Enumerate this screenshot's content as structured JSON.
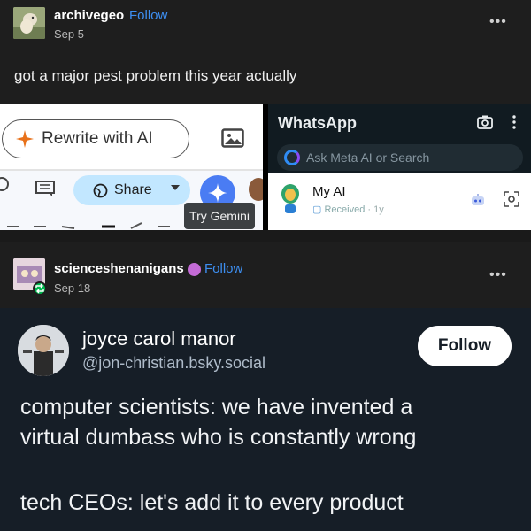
{
  "post1": {
    "username": "archivegeo",
    "follow_label": "Follow",
    "date": "Sep 5",
    "more_label": "•••",
    "text": "got a major pest problem this year actually"
  },
  "collage": {
    "left": {
      "rewrite_label": "Rewrite with AI",
      "share_label": "Share",
      "tooltip": "Try Gemini"
    },
    "right": {
      "app_title": "WhatsApp",
      "search_placeholder": "Ask Meta AI or Search",
      "chat_name": "My AI",
      "chat_status": "Received",
      "chat_time": "· 1y"
    }
  },
  "post2": {
    "username": "scienceshenanigans",
    "follow_label": "Follow",
    "date": "Sep 18",
    "more_label": "•••"
  },
  "bsky": {
    "display_name": "joyce carol manor",
    "handle": "@jon-christian.bsky.social",
    "follow_label": "Follow",
    "lines": [
      "computer scientists: we have invented a",
      "virtual dumbass who is constantly wrong",
      "tech CEOs: let's add it to every product"
    ]
  },
  "colors": {
    "tumblr_bg": "#1e1e1e",
    "follow_blue": "#3d8ef0",
    "bsky_bg": "#161e27",
    "whatsapp_bg": "#111b21"
  },
  "icons": [
    "camera-icon",
    "more-vertical-icon",
    "meta-ai-ring-icon",
    "robot-icon",
    "scan-icon",
    "image-icon",
    "sparkle-icon",
    "globe-icon",
    "gemini-sparkle-icon",
    "reblog-icon"
  ]
}
